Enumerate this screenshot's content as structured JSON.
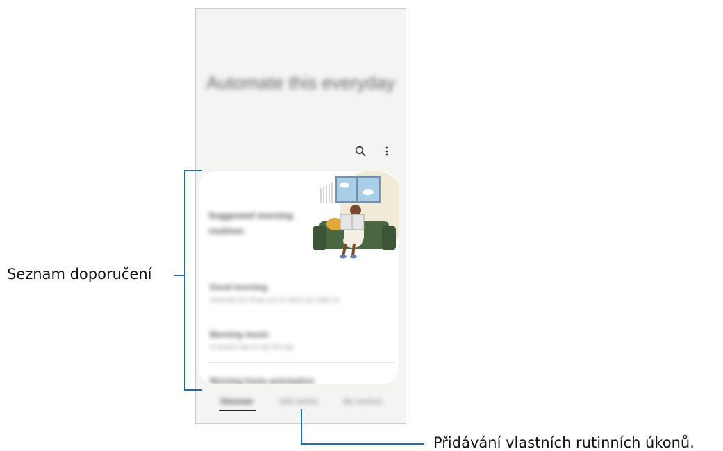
{
  "screen": {
    "hero_title": "Automate this everyday",
    "toolbar": {
      "search_icon": "search-icon",
      "more_icon": "more-options-icon"
    },
    "suggested": {
      "title": "Suggested morning routines",
      "items": [
        {
          "title": "Good morning",
          "subtitle": "Automate the things you do when you wake up"
        },
        {
          "title": "Morning music",
          "subtitle": "A cheerful way to start the day"
        },
        {
          "title": "Morning home automation",
          "subtitle": ""
        }
      ]
    },
    "tabs": [
      {
        "label": "Discover",
        "selected": true
      },
      {
        "label": "Add routine",
        "selected": false
      },
      {
        "label": "My routines",
        "selected": false
      }
    ]
  },
  "annotations": {
    "recommendations": "Seznam doporučení",
    "add_routine": "Přidávání vlastních rutinních úkonů."
  },
  "colors": {
    "callout_line": "#1a6eb5",
    "sofa": "#4a6741",
    "window": "#a9cfe8"
  }
}
